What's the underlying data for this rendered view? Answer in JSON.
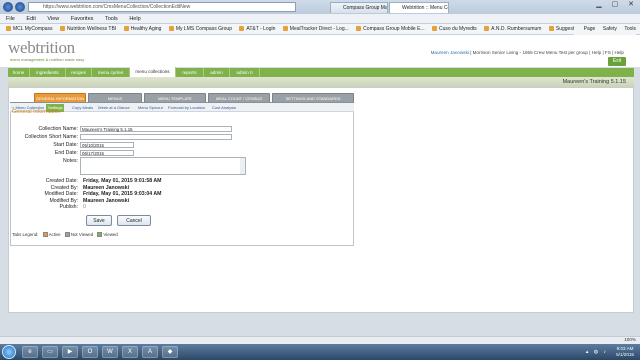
{
  "browser": {
    "url": "https://www.webtrition.com/CmsMenuCollection/CollectionEditNew",
    "tabs": [
      "Compass Group Managem...",
      "Webtrition :: Menu Collect..."
    ],
    "menu_items": [
      "File",
      "Edit",
      "View",
      "Favorites",
      "Tools",
      "Help"
    ],
    "favorites": [
      "MCL MyCompass",
      "Nutrition Wellness TBI",
      "Healthy Aging",
      "My LMS Compass Group",
      "AT&T - Login",
      "MealTracker Direct - Log...",
      "Compass Group Mobile E...",
      "Cuso du Myredts",
      "A.N.D. Rumbersumum",
      "Suggested Sites"
    ],
    "toolbar_right": [
      "Page",
      "Safety",
      "Tools"
    ],
    "zoom": "100%"
  },
  "app": {
    "logo": "webtrition",
    "tagline": "menu management & nutrition made easy",
    "user_prefix": "Maureen Janowski",
    "user_line": "| Morrison Senior Living - 1655 Crew Menu Test per group | Help | FS | Help",
    "exit_label": "Exit",
    "main_nav": [
      "home",
      "ingredients",
      "recipes",
      "menu cycles",
      "menu collections",
      "reports",
      "admin",
      "admin II"
    ],
    "collection_title": "Maureen's Training 5.1.15"
  },
  "section_tabs": [
    "GENERAL INFORMATION",
    "MENUS",
    "MENU TEMPLATE",
    "MEAL COUNT / CENSUS",
    "SETTINGS AND STANDARDS"
  ],
  "sub_nav": [
    "< Menu Collection",
    "Settings",
    "Copy Meals",
    "Week at a Glance",
    "Menu Spinout",
    "Forecast by Location",
    "Cost Analysis"
  ],
  "form": {
    "heading": "General Information",
    "collection_name_label": "Collection Name:",
    "collection_name": "Maureen's Training 5.1.15",
    "short_name_label": "Collection Short Name:",
    "short_name": "",
    "start_date_label": "Start Date:",
    "start_date": "05/10/2015",
    "end_date_label": "End Date:",
    "end_date": "06/17/2015",
    "notes_label": "Notes:",
    "created_date_label": "Created Date:",
    "created_date": "Friday, May 01, 2015 9:01:58 AM",
    "created_by_label": "Created By:",
    "created_by": "Maureen Janowski",
    "modified_date_label": "Modified Date:",
    "modified_date": "Friday, May 01, 2015 9:03:04 AM",
    "modified_by_label": "Modified By:",
    "modified_by": "Maureen Janowski",
    "publish_label": "Publish:",
    "publish": "0",
    "save_label": "Save",
    "cancel_label": "Cancel"
  },
  "legend": {
    "prefix": "Tabs Legend:",
    "items": [
      "Active",
      "Not Viewed",
      "Viewed"
    ],
    "colors": [
      "#e89a3a",
      "#9aa1a6",
      "#7fb24a"
    ]
  },
  "taskbar": {
    "time": "9:03 AM",
    "date": "5/1/2015"
  }
}
